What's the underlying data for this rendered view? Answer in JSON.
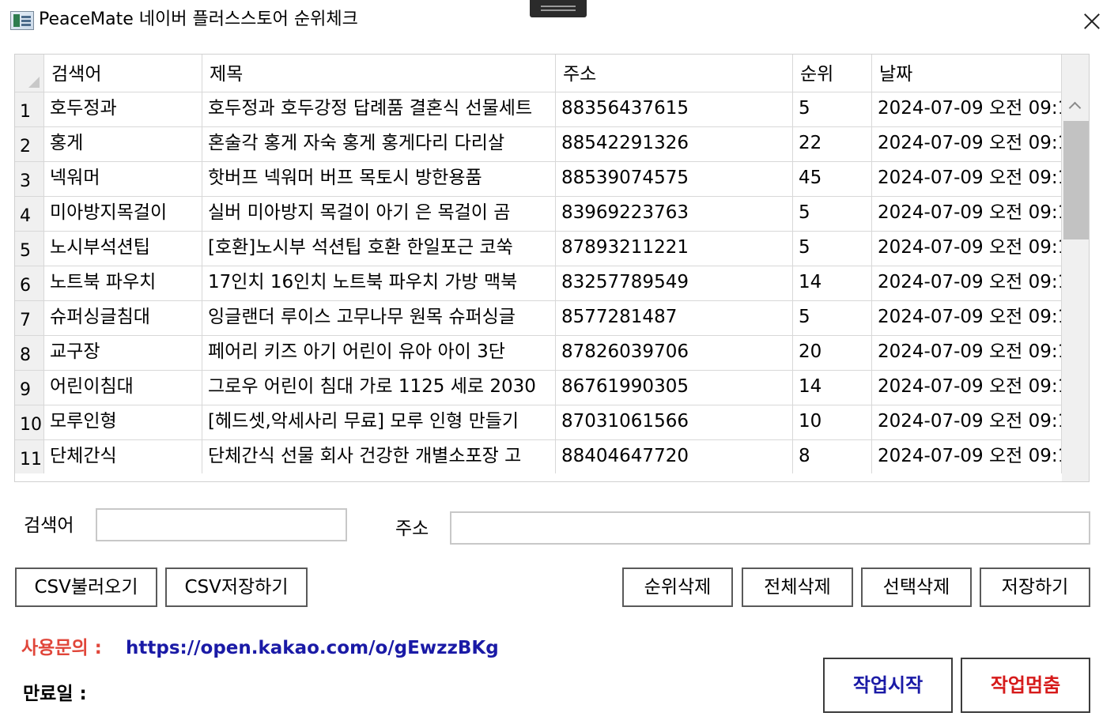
{
  "window": {
    "title": "PeaceMate 네이버 플러스스토어 순위체크",
    "icon": "app-icon",
    "close_icon": "close-icon"
  },
  "grid": {
    "columns": [
      "검색어",
      "제목",
      "주소",
      "순위",
      "날짜"
    ],
    "rows": [
      {
        "num": "1",
        "keyword": "호두정과",
        "title": "호두정과 호두강정 답례품 결혼식 선물세트",
        "address": "88356437615",
        "rank": "5",
        "date": "2024-07-09 오전 09:1"
      },
      {
        "num": "2",
        "keyword": "홍게",
        "title": "혼술각 홍게 자숙 홍게 홍게다리 다리살",
        "address": "88542291326",
        "rank": "22",
        "date": "2024-07-09 오전 09:1"
      },
      {
        "num": "3",
        "keyword": "넥워머",
        "title": "핫버프 넥워머 버프 목토시 방한용품",
        "address": "88539074575",
        "rank": "45",
        "date": "2024-07-09 오전 09:1"
      },
      {
        "num": "4",
        "keyword": "미아방지목걸이",
        "title": "실버 미아방지 목걸이 아기 은 목걸이 곰",
        "address": "83969223763",
        "rank": "5",
        "date": "2024-07-09 오전 09:1"
      },
      {
        "num": "5",
        "keyword": "노시부석션팁",
        "title": "[호환]노시부 석션팁 호환 한일포근 코쑥",
        "address": "87893211221",
        "rank": "5",
        "date": "2024-07-09 오전 09:1"
      },
      {
        "num": "6",
        "keyword": "노트북 파우치",
        "title": "17인치 16인치 노트북 파우치 가방 맥북",
        "address": "83257789549",
        "rank": "14",
        "date": "2024-07-09 오전 09:1"
      },
      {
        "num": "7",
        "keyword": "슈퍼싱글침대",
        "title": "잉글랜더 루이스 고무나무 원목 슈퍼싱글",
        "address": "8577281487",
        "rank": "5",
        "date": "2024-07-09 오전 09:1"
      },
      {
        "num": "8",
        "keyword": "교구장",
        "title": "페어리 키즈 아기 어린이 유아 아이 3단",
        "address": "87826039706",
        "rank": "20",
        "date": "2024-07-09 오전 09:1"
      },
      {
        "num": "9",
        "keyword": "어린이침대",
        "title": "그로우 어린이 침대 가로 1125 세로 2030",
        "address": "86761990305",
        "rank": "14",
        "date": "2024-07-09 오전 09:1"
      },
      {
        "num": "10",
        "keyword": "모루인형",
        "title": "[헤드셋,악세사리 무료] 모루 인형 만들기",
        "address": "87031061566",
        "rank": "10",
        "date": "2024-07-09 오전 09:1"
      },
      {
        "num": "11",
        "keyword": "단체간식",
        "title": "단체간식 선물 회사 건강한 개별소포장 고",
        "address": "88404647720",
        "rank": "8",
        "date": "2024-07-09 오전 09:1"
      }
    ]
  },
  "form": {
    "keyword_label": "검색어",
    "keyword_value": "",
    "address_label": "주소",
    "address_value": ""
  },
  "buttons": {
    "csv_load": "CSV불러오기",
    "csv_save": "CSV저장하기",
    "delete_rank": "순위삭제",
    "delete_all": "전체삭제",
    "delete_selected": "선택삭제",
    "save": "저장하기",
    "start": "작업시작",
    "stop": "작업멈춤"
  },
  "footer": {
    "contact_label": "사용문의 :",
    "contact_link": "https://open.kakao.com/o/gEwzzBKg",
    "expiry_label": "만료일 :"
  },
  "colors": {
    "contact_label": "#e0463a",
    "link": "#1a1aa6",
    "start_button_text": "#1a1aa6",
    "stop_button_text": "#d61a1a"
  }
}
